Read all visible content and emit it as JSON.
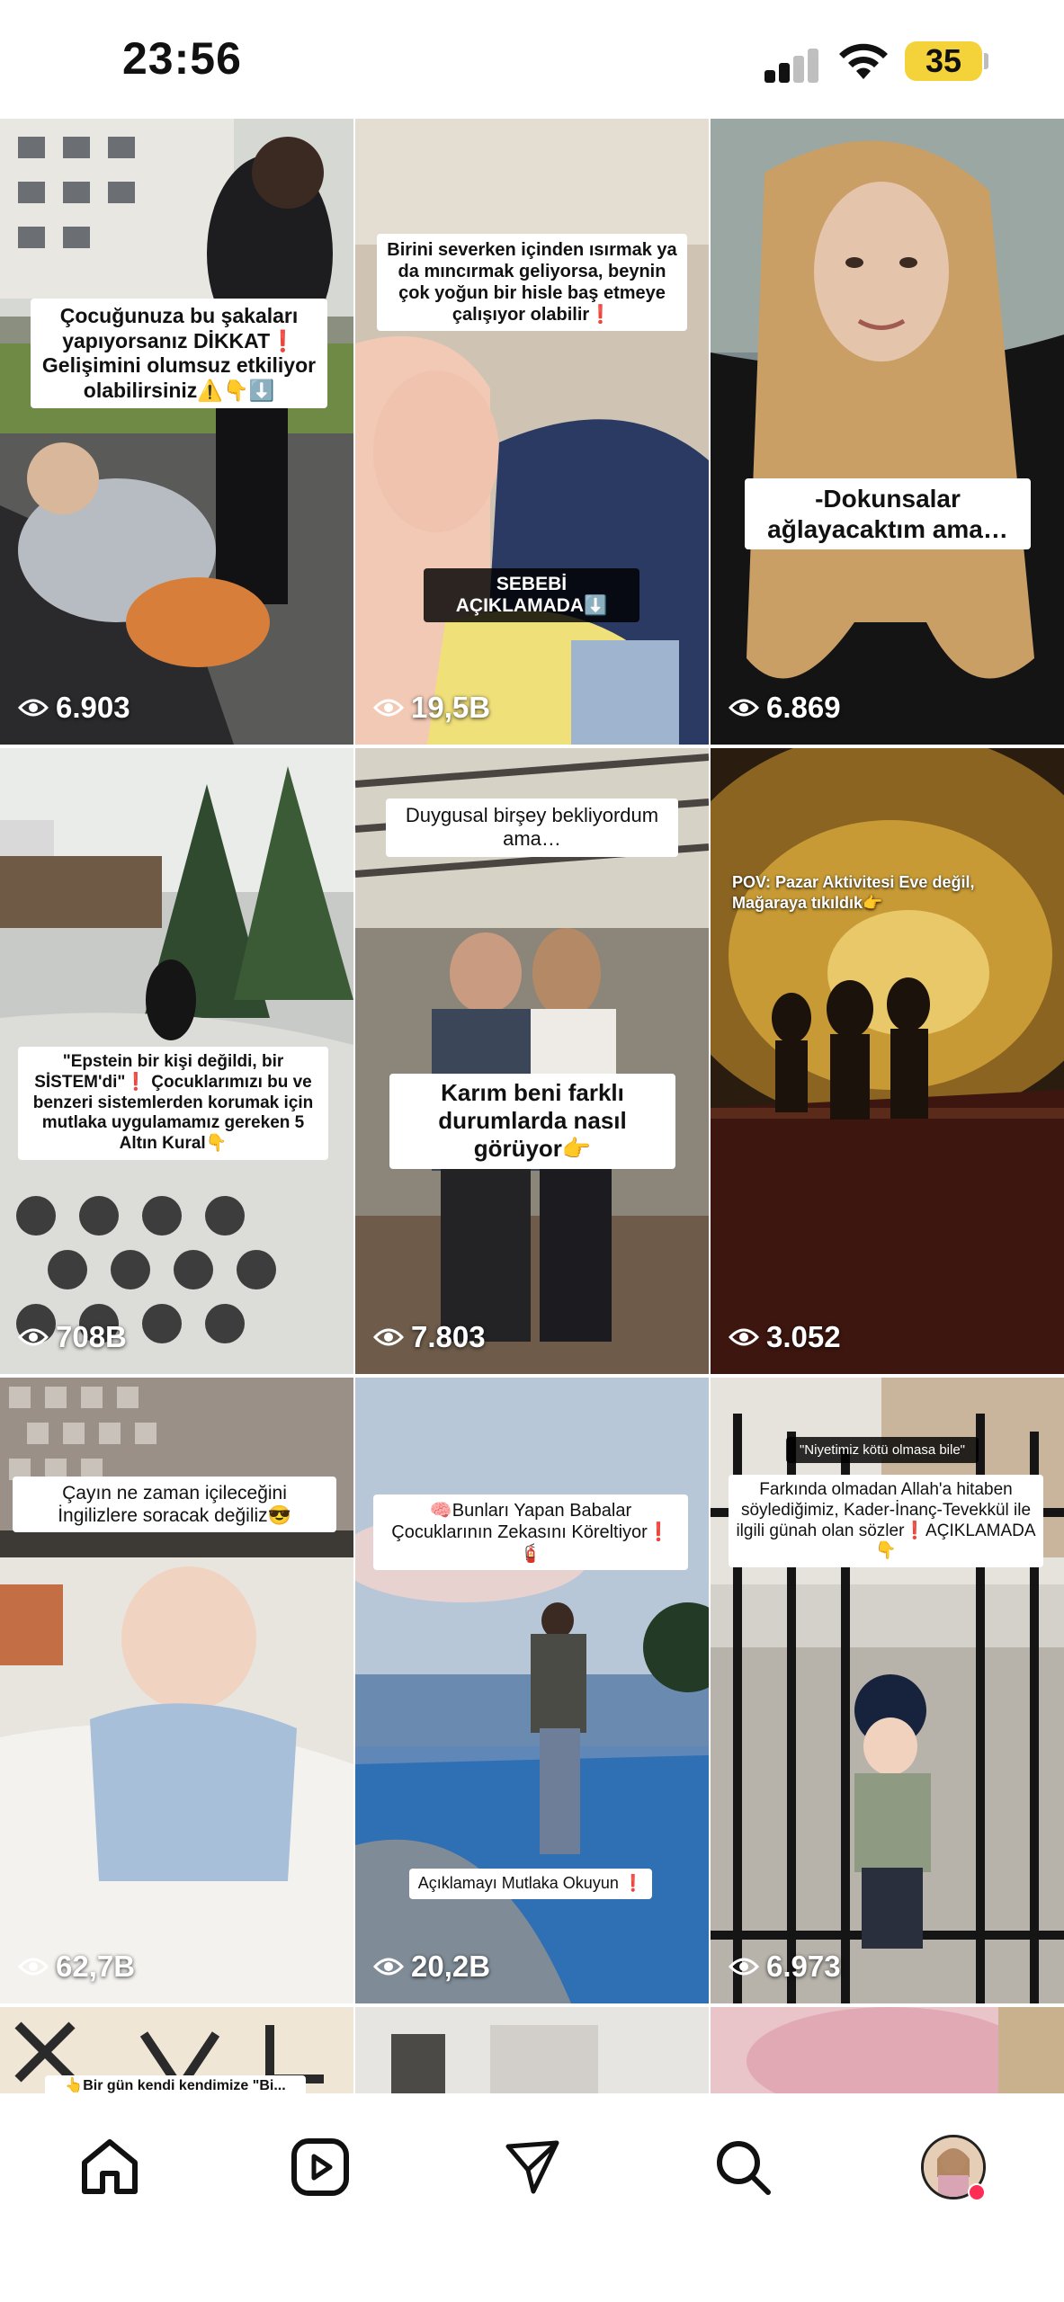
{
  "status": {
    "time": "23:56",
    "battery": "35",
    "icons": [
      "cellular-signal-icon",
      "wifi-icon",
      "battery-icon"
    ]
  },
  "posts": [
    {
      "caption": "Çocuğunuza bu şakaları yapıyorsanız DİKKAT❗ Gelişimini olumsuz etkiliyor olabilirsiniz⚠️👇⬇️",
      "views": "6.903"
    },
    {
      "caption": "Birini severken içinden ısırmak ya da mıncırmak geliyorsa, beynin çok yoğun bir hisle baş etmeye çalışıyor olabilir❗",
      "caption2": "SEBEBİ AÇIKLAMADA⬇️",
      "views": "19,5B"
    },
    {
      "caption": "-Dokunsalar ağlayacaktım ama…",
      "views": "6.869"
    },
    {
      "caption": "\"Epstein bir kişi değildi, bir SİSTEM'di\"❗ Çocuklarımızı bu ve benzeri sistemlerden korumak için mutlaka uygulamamız gereken 5 Altın Kural👇",
      "views": "708B"
    },
    {
      "caption": "Duygusal birşey bekliyordum ama…",
      "caption2": "Karım beni farklı durumlarda nasıl görüyor👉",
      "views": "7.803"
    },
    {
      "caption": "POV: Pazar Aktivitesi Eve değil, Mağaraya tıkıldık👉",
      "views": "3.052"
    },
    {
      "caption": "Çayın ne zaman içileceğini İngilizlere soracak değiliz😎",
      "views": "62,7B"
    },
    {
      "caption": "🧠Bunları Yapan Babalar Çocuklarının Zekasını Köreltiyor❗🧯",
      "caption2": "Açıklamayı Mutlaka Okuyun ❗",
      "views": "20,2B"
    },
    {
      "caption": "\"Niyetimiz kötü olmasa bile\"",
      "caption2": "Farkında olmadan Allah'a hitaben söylediğimiz, Kader-İnanç-Tevekkül ile ilgili günah olan sözler❗AÇIKLAMADA👇",
      "views": "6.973"
    }
  ],
  "partial_row_caption": "👆Bir gün kendi kendimize \"Bi...",
  "nav": {
    "items": [
      "home-icon",
      "reels-icon",
      "direct-messages-icon",
      "search-icon",
      "profile-avatar"
    ]
  },
  "colors": {
    "battery": "#f4d23a",
    "notification_dot": "#ff2d55"
  }
}
